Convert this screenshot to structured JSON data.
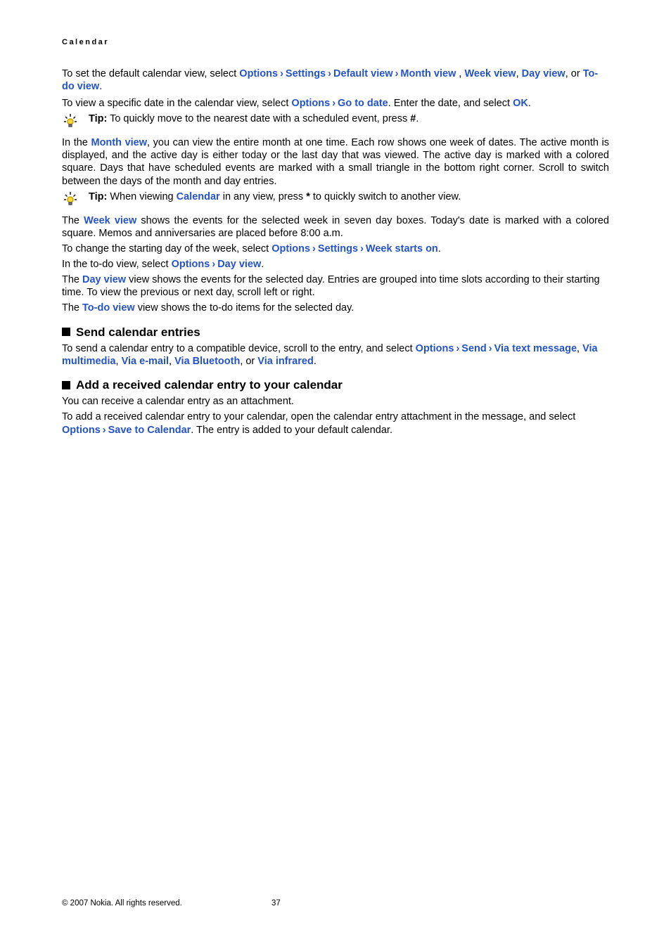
{
  "header": "Calendar",
  "p1_pre": "To set the default calendar view, select ",
  "opt": "Options",
  "set": "Settings",
  "defv": "Default view",
  "mv": "Month view",
  "wv": "Week view",
  "dv": "Day view",
  "or": ", or ",
  "tdv": "To-do view",
  "p2_pre": "To view a specific date in the calendar view, select ",
  "gtd": "Go to date",
  "p2_mid": ". Enter the date, and select ",
  "ok": "OK",
  "tip_lbl": "Tip:",
  "tip1_body": "  To quickly move to the nearest date with a scheduled event, press ",
  "hash": "#",
  "p3_pre": "In the ",
  "p3_body": ", you can view the entire month at one time. Each row shows one week of dates. The active month is displayed, and the active day is either today or the last day that was viewed. The active day is marked with a colored square. Days that have scheduled events are marked with a small triangle in the bottom right corner. Scroll to switch between the days of the month and day entries.",
  "tip2_a": " When viewing ",
  "cal": "Calendar",
  "tip2_b": " in any view, press ",
  "star": "*",
  "tip2_c": " to quickly switch to another view.",
  "p4_pre": "The ",
  "p4_body": " shows the events for the selected week in seven day boxes. Today's date is marked with a colored square. Memos and anniversaries are placed before 8:00 a.m.",
  "p5_pre": "To change the starting day of the week, select ",
  "wso": "Week starts on",
  "p6_pre": "In the to-do view, select ",
  "p7_pre": "The ",
  "p7_body": " view shows the events for the selected day. Entries are grouped into time slots according to their starting time. To view the previous or next day, scroll left or right.",
  "p8_body": " view shows the to-do items for the selected day.",
  "h1": "Send calendar entries",
  "p9_pre": "To send a calendar entry to a compatible device, scroll to the entry, and select ",
  "send": "Send",
  "vtm": "Via text message",
  "vmm": "Via multimedia",
  "vem": "Via e-mail",
  "vbt": "Via Bluetooth",
  "vir": "Via infrared",
  "h2": "Add a received calendar entry to your calendar",
  "p10": "You can receive a calendar entry as an attachment.",
  "p11_pre": "To add a received calendar entry to your calendar, open the calendar entry attachment in the message, and select ",
  "stc": "Save to Calendar",
  "p11_post": ". The entry is added to your default calendar.",
  "copyright": "© 2007 Nokia. All rights reserved.",
  "page_no": "37"
}
